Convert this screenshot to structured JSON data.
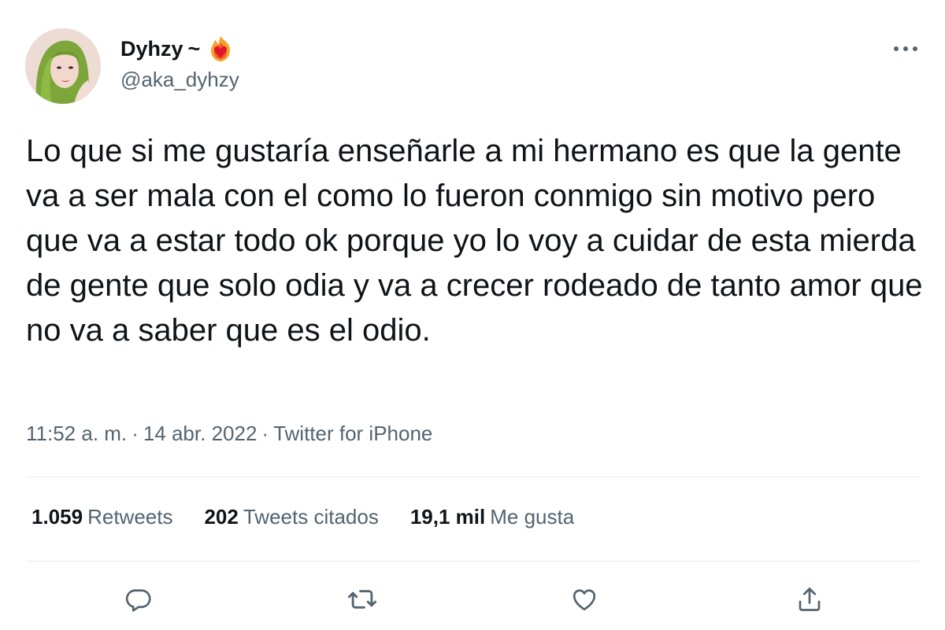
{
  "author": {
    "display_name": "Dyhzy",
    "name_suffix": "~",
    "handle": "@aka_dyhzy",
    "avatar_icon": "profile-photo-green-hair",
    "badge_icon": "heart-on-fire-emoji"
  },
  "tweet": {
    "text": "Lo que si me gustaría enseñarle a mi hermano es que la gente va a ser mala con el como lo fueron conmigo sin motivo pero que va a estar todo ok porque yo lo voy a cuidar de esta mierda de gente que solo odia y va a crecer rodeado de tanto amor que no va a saber que es el odio.",
    "time": "11:52 a. m.",
    "date": "14 abr. 2022",
    "separator": "·",
    "source": "Twitter for iPhone"
  },
  "stats": [
    {
      "value": "1.059",
      "label": "Retweets"
    },
    {
      "value": "202",
      "label": "Tweets citados"
    },
    {
      "value": "19,1 mil",
      "label": "Me gusta"
    }
  ],
  "actions": {
    "reply_icon": "reply-icon",
    "retweet_icon": "retweet-icon",
    "like_icon": "like-icon",
    "share_icon": "share-icon"
  },
  "colors": {
    "text_primary": "#0f1419",
    "text_secondary": "#536471",
    "divider": "#e6ebee",
    "background": "#ffffff"
  }
}
